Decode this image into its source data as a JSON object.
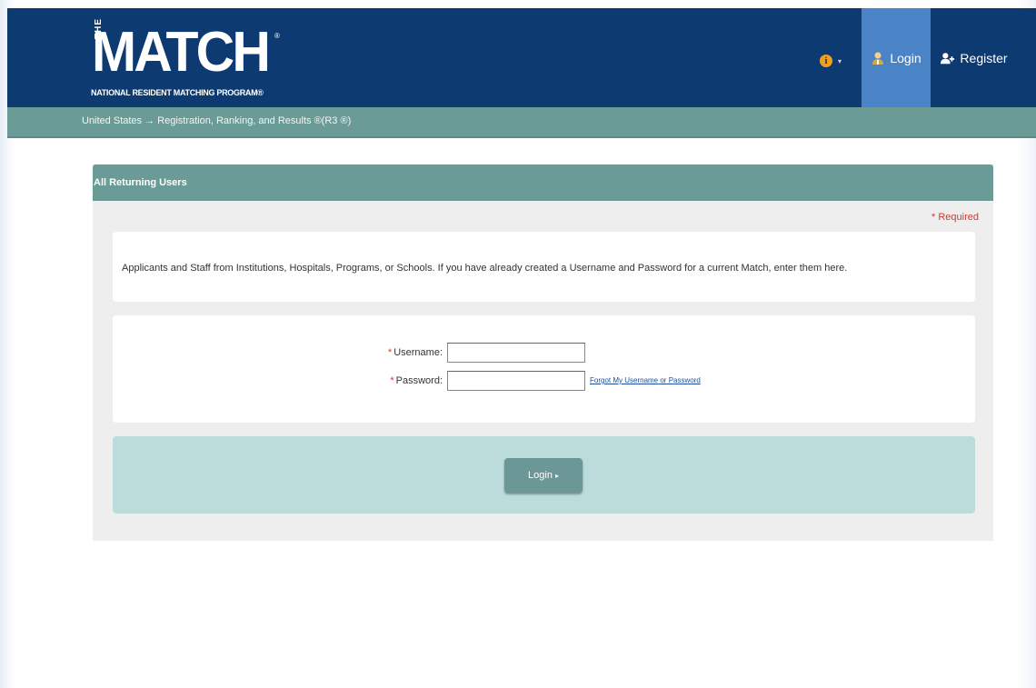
{
  "header": {
    "logo": {
      "the": "THE",
      "match": "MATCH",
      "reg": "®",
      "subtitle": "NATIONAL RESIDENT MATCHING PROGRAM®"
    },
    "nav": {
      "info_icon": "info-icon",
      "info_caret": "▾",
      "login_label": "Login",
      "login_icon": "user-icon",
      "register_label": "Register",
      "register_icon": "add-user-icon"
    },
    "breadcrumb": "United States  → Registration, Ranking, and Results ®(R3 ®)"
  },
  "panel": {
    "title": "All Returning Users",
    "required_note": "* Required",
    "info_text": "Applicants and Staff from Institutions, Hospitals, Programs, or Schools. If you have already created a Username and Password for a current Match, enter them here.",
    "username_label": "Username:",
    "password_label": "Password:",
    "required_star": "*",
    "username_value": "",
    "password_value": "",
    "forgot_link": "Forgot My Username or Password",
    "login_button": "Login",
    "login_caret": "▸"
  },
  "colors": {
    "header_bg": "#0e3a72",
    "nav_active": "#4a83c6",
    "teal": "#6b9b96",
    "action_bg": "#bcdcdc",
    "required_red": "#d9362b",
    "info_orange": "#f0a020"
  }
}
